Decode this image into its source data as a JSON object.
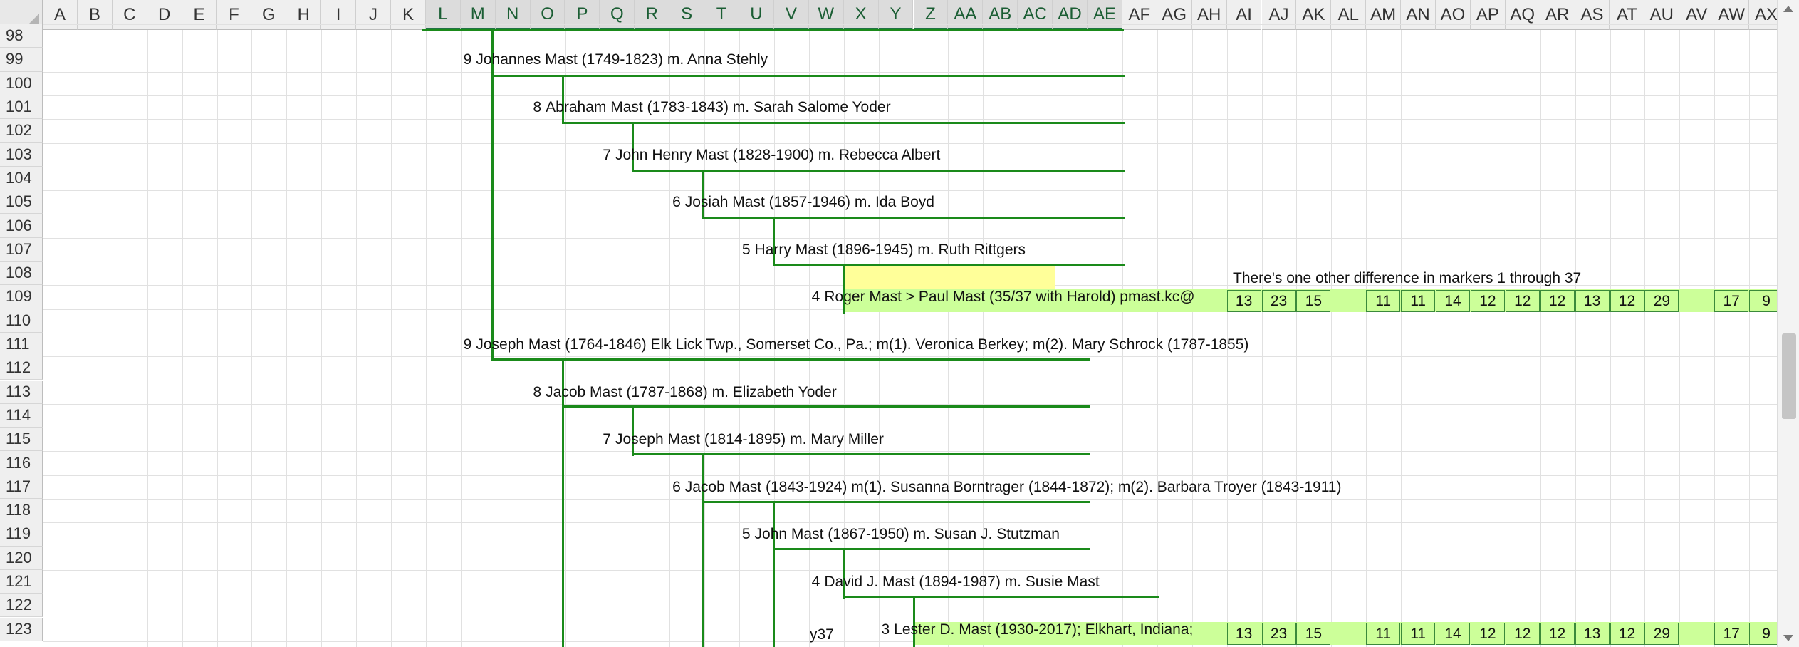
{
  "columns": [
    "A",
    "B",
    "C",
    "D",
    "E",
    "F",
    "G",
    "H",
    "I",
    "J",
    "K",
    "L",
    "M",
    "N",
    "O",
    "P",
    "Q",
    "R",
    "S",
    "T",
    "U",
    "V",
    "W",
    "X",
    "Y",
    "Z",
    "AA",
    "AB",
    "AC",
    "AD",
    "AE",
    "AF",
    "AG",
    "AH",
    "AI",
    "AJ",
    "AK",
    "AL",
    "AM",
    "AN",
    "AO",
    "AP",
    "AQ",
    "AR",
    "AS",
    "AT",
    "AU",
    "AV",
    "AW",
    "AX"
  ],
  "selected_columns": [
    "L",
    "M",
    "N",
    "O",
    "P",
    "Q",
    "R",
    "S",
    "T",
    "U",
    "V",
    "W",
    "X",
    "Y",
    "Z",
    "AA",
    "AB",
    "AC",
    "AD",
    "AE"
  ],
  "rows": [
    "98",
    "99",
    "100",
    "101",
    "102",
    "103",
    "104",
    "105",
    "106",
    "107",
    "108",
    "109",
    "110",
    "111",
    "112",
    "113",
    "114",
    "115",
    "116",
    "117",
    "118",
    "119",
    "120",
    "121",
    "122",
    "123"
  ],
  "entries": [
    {
      "gen": "9",
      "text": "Johannes Mast (1749-1823) m. Anna Stehly"
    },
    {
      "gen": "8",
      "text": "Abraham Mast (1783-1843) m. Sarah Salome Yoder"
    },
    {
      "gen": "7",
      "text": "John Henry Mast (1828-1900) m. Rebecca Albert"
    },
    {
      "gen": "6",
      "text": "Josiah Mast (1857-1946) m. Ida Boyd"
    },
    {
      "gen": "5",
      "text": "Harry Mast (1896-1945) m. Ruth Rittgers"
    },
    {
      "gen": "4",
      "text": "Roger Mast > Paul Mast (35/37 with Harold) pmast.kc@"
    },
    {
      "gen": "9",
      "text": "Joseph Mast (1764-1846) Elk Lick Twp., Somerset Co., Pa.; m(1). Veronica Berkey; m(2). Mary Schrock (1787-1855)"
    },
    {
      "gen": "8",
      "text": "Jacob Mast (1787-1868) m. Elizabeth Yoder"
    },
    {
      "gen": "7",
      "text": "Joseph Mast (1814-1895) m. Mary Miller"
    },
    {
      "gen": "6",
      "text": "Jacob Mast (1843-1924) m(1). Susanna Borntrager (1844-1872); m(2). Barbara Troyer (1843-1911)"
    },
    {
      "gen": "5",
      "text": "John Mast (1867-1950) m. Susan J. Stutzman"
    },
    {
      "gen": "4",
      "text": "David J. Mast (1894-1987) m. Susie Mast"
    },
    {
      "gen": "3",
      "text": "Lester D. Mast (1930-2017); Elkhart, Indiana;"
    }
  ],
  "note": "There's one other difference in markers 1 through 37",
  "y_label": "y37",
  "markers_row109": [
    "13",
    "23",
    "15",
    "",
    "11",
    "11",
    "14",
    "12",
    "12",
    "12",
    "13",
    "12",
    "29",
    "",
    "17",
    "9"
  ],
  "markers_row123": [
    "13",
    "23",
    "15",
    "",
    "11",
    "11",
    "14",
    "12",
    "12",
    "12",
    "13",
    "12",
    "29",
    "",
    "17",
    "9"
  ],
  "colors": {
    "line": "#1a8a1a",
    "marker_fill": "#ccff99",
    "highlight": "#ffff99",
    "header_select": "#217346"
  }
}
